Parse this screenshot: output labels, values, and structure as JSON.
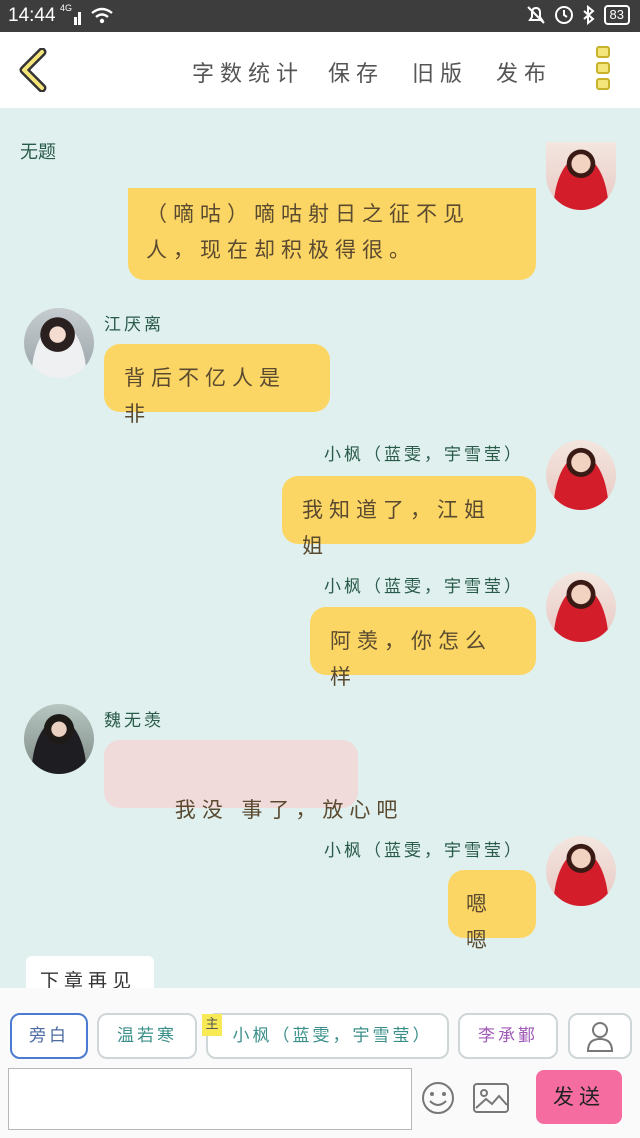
{
  "status": {
    "time": "14:44",
    "network": "4G",
    "battery": "83"
  },
  "toolbar": {
    "word_count": "字数统计",
    "save": "保存",
    "old_version": "旧版",
    "publish": "发布"
  },
  "chat": {
    "title": "无题",
    "messages": [
      {
        "text_line1": "（嘀咕）嘀咕射日之征不见",
        "text_line2": "人，现在却积极得很。"
      },
      {
        "name": "江厌离",
        "text": "背后不亿人是非"
      },
      {
        "name": "小枫（蓝雯，宇雪莹）",
        "text": "我知道了，江姐姐"
      },
      {
        "name": "小枫（蓝雯，宇雪莹）",
        "text": "阿羡，你怎么样"
      },
      {
        "name": "魏无羡",
        "text": "我没 事了，放心吧"
      },
      {
        "name": "小枫（蓝雯，宇雪莹）",
        "text": "嗯嗯"
      }
    ],
    "narration": "下章再见"
  },
  "bottom": {
    "roles": [
      "旁白",
      "温若寒",
      "小枫（蓝雯，宇雪莹）",
      "李承鄞"
    ],
    "main_badge": "主",
    "input_value": "",
    "send": "发送"
  },
  "colors": {
    "bubble_yellow": "#fcd664",
    "bubble_pink": "#f1dada",
    "background": "#dff0ef",
    "send_button": "#f56da0"
  }
}
